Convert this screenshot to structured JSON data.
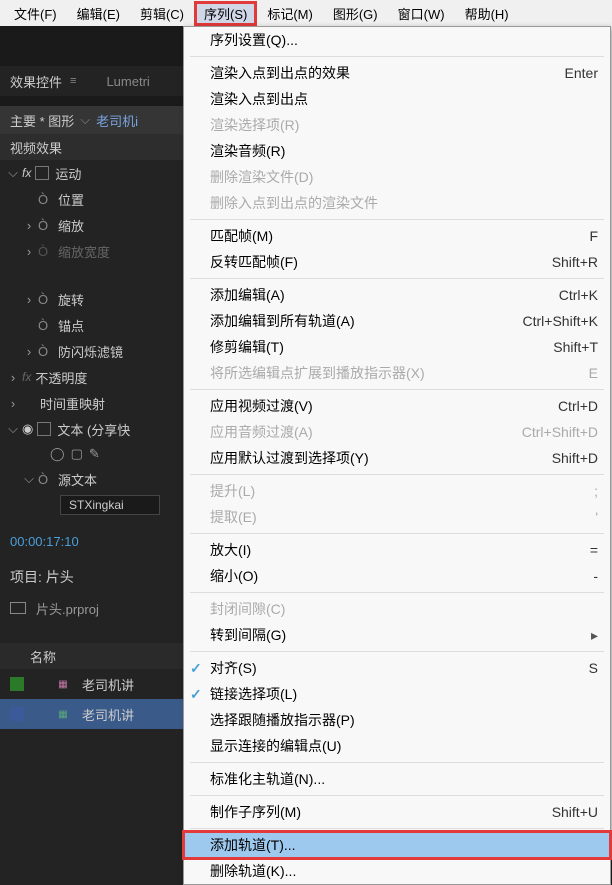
{
  "menubar": {
    "file": "文件(F)",
    "edit": "编辑(E)",
    "clip": "剪辑(C)",
    "sequence": "序列(S)",
    "marker": "标记(M)",
    "graphics": "图形(G)",
    "window": "窗口(W)",
    "help": "帮助(H)"
  },
  "panel": {
    "effects_controls": "效果控件",
    "lumetri": "Lumetri",
    "breadcrumb_main": "主要 * 图形",
    "breadcrumb_clip": "老司机i"
  },
  "effects": {
    "video_effects": "视频效果",
    "motion": "运动",
    "position": "位置",
    "scale": "缩放",
    "scale_width": "缩放宽度",
    "rotation": "旋转",
    "anchor": "锚点",
    "anti_flicker": "防闪烁滤镜",
    "opacity": "不透明度",
    "time_remap": "时间重映射",
    "text_group": "文本 (分享快",
    "source_text": "源文本",
    "font_name": "STXingkai"
  },
  "timecode": "00:00:17:10",
  "project": {
    "title": "项目: 片头",
    "file": "片头.prproj",
    "name_col": "名称",
    "item1": "老司机讲",
    "item2": "老司机讲"
  },
  "dropdown": {
    "seq_settings": "序列设置(Q)...",
    "render_inout_effects": "渲染入点到出点的效果",
    "render_inout": "渲染入点到出点",
    "render_selection": "渲染选择项(R)",
    "render_audio": "渲染音频(R)",
    "delete_render": "删除渲染文件(D)",
    "delete_inout_render": "删除入点到出点的渲染文件",
    "match_frame": "匹配帧(M)",
    "reverse_match": "反转匹配帧(F)",
    "add_edit": "添加编辑(A)",
    "add_edit_all": "添加编辑到所有轨道(A)",
    "trim_edit": "修剪编辑(T)",
    "extend_edit": "将所选编辑点扩展到播放指示器(X)",
    "apply_video_trans": "应用视频过渡(V)",
    "apply_audio_trans": "应用音频过渡(A)",
    "apply_default_trans": "应用默认过渡到选择项(Y)",
    "lift": "提升(L)",
    "extract": "提取(E)",
    "zoom_in": "放大(I)",
    "zoom_out": "缩小(O)",
    "close_gap": "封闭间隙(C)",
    "go_to_gap": "转到间隔(G)",
    "snap": "对齐(S)",
    "linked_selection": "链接选择项(L)",
    "selection_follows": "选择跟随播放指示器(P)",
    "show_through_edits": "显示连接的编辑点(U)",
    "normalize_master": "标准化主轨道(N)...",
    "make_subsequence": "制作子序列(M)",
    "add_tracks": "添加轨道(T)...",
    "delete_tracks": "删除轨道(K)...",
    "sc_enter": "Enter",
    "sc_f": "F",
    "sc_shift_r": "Shift+R",
    "sc_ctrl_k": "Ctrl+K",
    "sc_ctrl_shift_k": "Ctrl+Shift+K",
    "sc_shift_t": "Shift+T",
    "sc_e": "E",
    "sc_ctrl_d": "Ctrl+D",
    "sc_ctrl_shift_d": "Ctrl+Shift+D",
    "sc_shift_d": "Shift+D",
    "sc_semi": ";",
    "sc_apos": "'",
    "sc_eq": "=",
    "sc_minus": "-",
    "sc_s": "S",
    "sc_shift_u": "Shift+U"
  }
}
